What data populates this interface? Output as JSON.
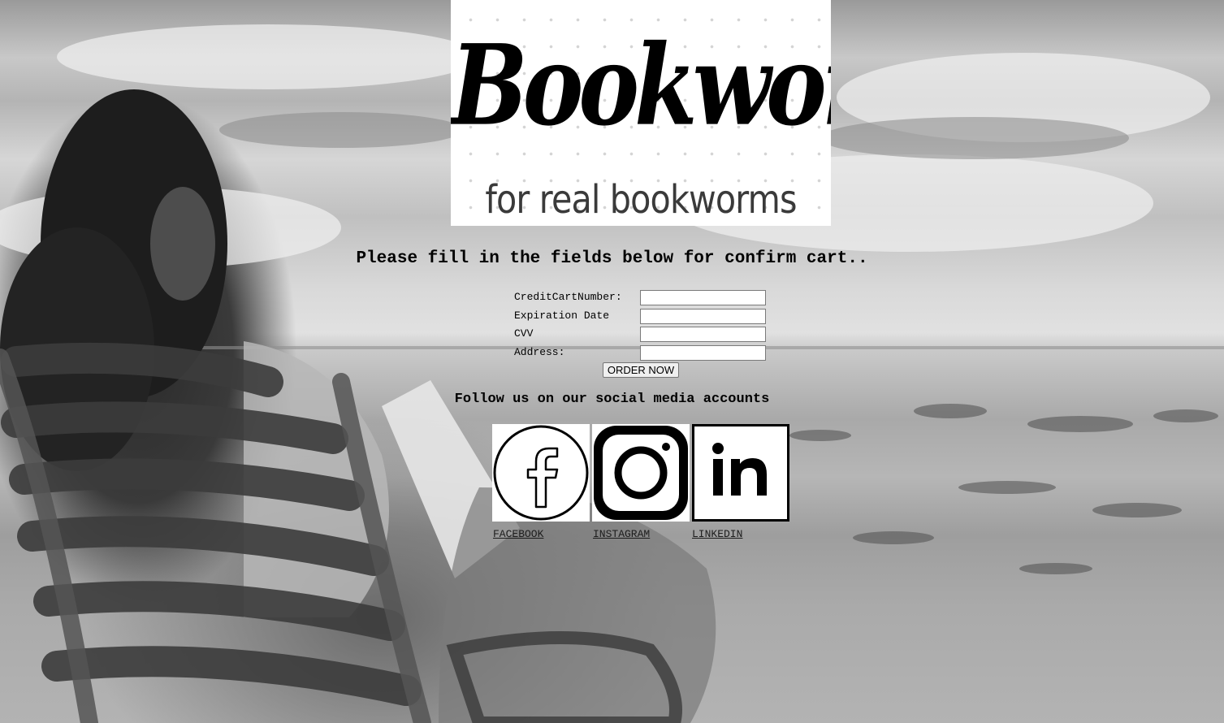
{
  "logo": {
    "title": "Bookworm",
    "tagline": "for real bookworms"
  },
  "prompt": "Please fill in the fields below for confirm cart..",
  "form": {
    "fields": [
      {
        "label": "CreditCartNumber:",
        "value": ""
      },
      {
        "label": "Expiration Date",
        "value": ""
      },
      {
        "label": "CVV",
        "value": ""
      },
      {
        "label": "Address:",
        "value": ""
      }
    ],
    "submit_label": "ORDER NOW"
  },
  "social": {
    "heading": "Follow us on our social media accounts",
    "links": [
      {
        "label": "FACEBOOK",
        "icon": "facebook-icon"
      },
      {
        "label": "INSTAGRAM",
        "icon": "instagram-icon"
      },
      {
        "label": "LINKEDIN",
        "icon": "linkedin-icon"
      }
    ]
  }
}
